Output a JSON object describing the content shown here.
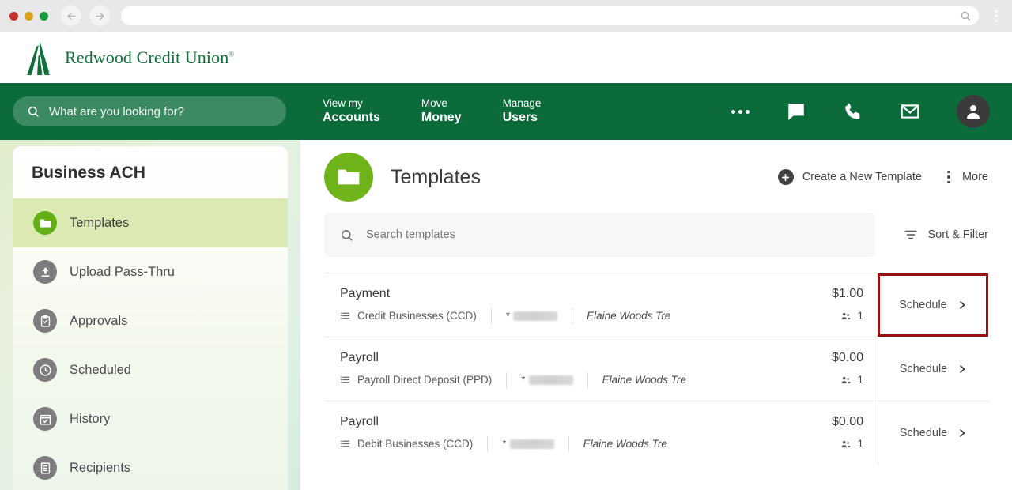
{
  "browser": {
    "back_icon": "back-arrow-icon",
    "forward_icon": "forward-arrow-icon",
    "url_value": "",
    "url_search_icon": "search-icon",
    "menu_icon": "browser-menu-icon"
  },
  "brand": {
    "name": "Redwood Credit Union",
    "trademark": "®",
    "logo_icon": "redwood-tree-logo",
    "color": "#11703a"
  },
  "topnav": {
    "search": {
      "placeholder": "What are you looking for?",
      "icon": "search-icon"
    },
    "links": [
      {
        "line1": "View my",
        "line2": "Accounts"
      },
      {
        "line1": "Move",
        "line2": "Money"
      },
      {
        "line1": "Manage",
        "line2": "Users"
      }
    ],
    "icons": [
      {
        "name": "ellipsis-icon",
        "label": "More"
      },
      {
        "name": "chat-icon",
        "label": "Messages"
      },
      {
        "name": "phone-icon",
        "label": "Call"
      },
      {
        "name": "envelope-icon",
        "label": "Mail"
      },
      {
        "name": "avatar-icon",
        "label": "Profile"
      }
    ],
    "bar_color": "#0b6b3a",
    "search_color": "#3c8a62"
  },
  "sidebar": {
    "title": "Business ACH",
    "active_color": "#dbe9b2",
    "items": [
      {
        "label": "Templates",
        "icon": "folder-icon",
        "active": true
      },
      {
        "label": "Upload Pass-Thru",
        "icon": "upload-icon",
        "active": false
      },
      {
        "label": "Approvals",
        "icon": "approval-icon",
        "active": false
      },
      {
        "label": "Scheduled",
        "icon": "clock-icon",
        "active": false
      },
      {
        "label": "History",
        "icon": "calendar-icon",
        "active": false
      },
      {
        "label": "Recipients",
        "icon": "list-icon",
        "active": false
      }
    ]
  },
  "main": {
    "title": "Templates",
    "title_icon": "folder-icon",
    "title_icon_color": "#6eb41a",
    "create_label": "Create a New Template",
    "create_icon": "plus-icon",
    "more_label": "More",
    "more_icon": "kebab-icon",
    "search_placeholder": "Search templates",
    "search_icon": "search-icon",
    "sort_filter_label": "Sort & Filter",
    "sort_filter_icon": "filter-icon",
    "highlight_color": "#9c1010",
    "rows": [
      {
        "name": "Payment",
        "type": "Credit Businesses (CCD)",
        "account_mask": "*",
        "person": "Elaine Woods Tre",
        "amount": "$1.00",
        "count": "1",
        "action_label": "Schedule",
        "highlighted": true
      },
      {
        "name": "Payroll",
        "type": "Payroll Direct Deposit (PPD)",
        "account_mask": "*",
        "person": "Elaine Woods Tre",
        "amount": "$0.00",
        "count": "1",
        "action_label": "Schedule",
        "highlighted": false
      },
      {
        "name": "Payroll",
        "type": "Debit Businesses (CCD)",
        "account_mask": "*",
        "person": "Elaine Woods Tre",
        "amount": "$0.00",
        "count": "1",
        "action_label": "Schedule",
        "highlighted": false
      }
    ]
  }
}
